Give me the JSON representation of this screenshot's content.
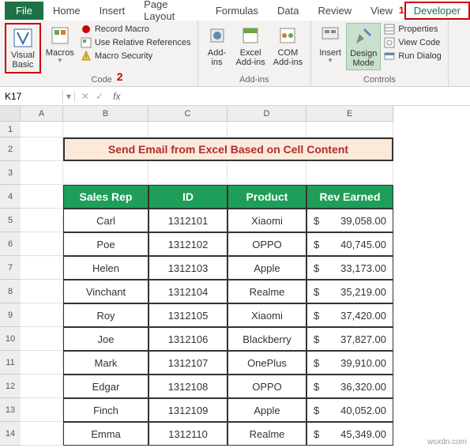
{
  "tabs": {
    "file": "File",
    "home": "Home",
    "insert": "Insert",
    "pageLayout": "Page Layout",
    "formulas": "Formulas",
    "data": "Data",
    "review": "Review",
    "view": "View",
    "developer": "Developer"
  },
  "callout1": "1",
  "callout2": "2",
  "ribbon": {
    "code": {
      "visualBasic": "Visual\nBasic",
      "macros": "Macros",
      "recordMacro": "Record Macro",
      "useRelRef": "Use Relative References",
      "macroSecurity": "Macro Security",
      "label": "Code"
    },
    "addins": {
      "addins": "Add-\nins",
      "excelAddins": "Excel\nAdd-ins",
      "comAddins": "COM\nAdd-ins",
      "label": "Add-ins"
    },
    "controls": {
      "insert": "Insert",
      "designMode": "Design\nMode",
      "properties": "Properties",
      "viewCode": "View Code",
      "runDialog": "Run Dialog",
      "label": "Controls"
    }
  },
  "nameBox": "K17",
  "columns": [
    "A",
    "B",
    "C",
    "D",
    "E"
  ],
  "rowNums": [
    "1",
    "2",
    "3",
    "4",
    "5",
    "6",
    "7",
    "8",
    "9",
    "10",
    "11",
    "12",
    "13",
    "14"
  ],
  "title": "Send Email from Excel Based on Cell Content",
  "headers": {
    "b": "Sales Rep",
    "c": "ID",
    "d": "Product",
    "e": "Rev Earned"
  },
  "rows": [
    {
      "rep": "Carl",
      "id": "1312101",
      "product": "Xiaomi",
      "cur": "$",
      "rev": "39,058.00"
    },
    {
      "rep": "Poe",
      "id": "1312102",
      "product": "OPPO",
      "cur": "$",
      "rev": "40,745.00"
    },
    {
      "rep": "Helen",
      "id": "1312103",
      "product": "Apple",
      "cur": "$",
      "rev": "33,173.00"
    },
    {
      "rep": "Vinchant",
      "id": "1312104",
      "product": "Realme",
      "cur": "$",
      "rev": "35,219.00"
    },
    {
      "rep": "Roy",
      "id": "1312105",
      "product": "Xiaomi",
      "cur": "$",
      "rev": "37,420.00"
    },
    {
      "rep": "Joe",
      "id": "1312106",
      "product": "Blackberry",
      "cur": "$",
      "rev": "37,827.00"
    },
    {
      "rep": "Mark",
      "id": "1312107",
      "product": "OnePlus",
      "cur": "$",
      "rev": "39,910.00"
    },
    {
      "rep": "Edgar",
      "id": "1312108",
      "product": "OPPO",
      "cur": "$",
      "rev": "36,320.00"
    },
    {
      "rep": "Finch",
      "id": "1312109",
      "product": "Apple",
      "cur": "$",
      "rev": "40,052.00"
    },
    {
      "rep": "Emma",
      "id": "1312110",
      "product": "Realme",
      "cur": "$",
      "rev": "45,349.00"
    }
  ],
  "watermark": "wsxdn.com"
}
